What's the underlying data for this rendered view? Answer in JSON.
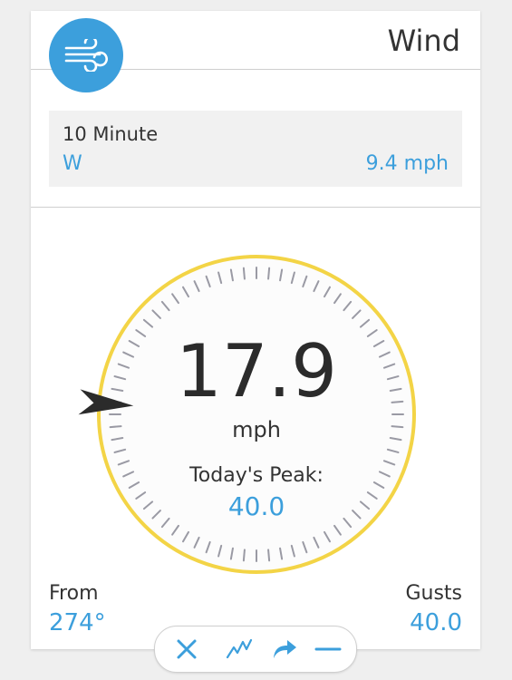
{
  "header": {
    "title": "Wind",
    "icon": "wind-icon"
  },
  "ten_minute": {
    "label": "10 Minute",
    "direction": "W",
    "speed": "9.4 mph"
  },
  "gauge": {
    "speed": "17.9",
    "unit": "mph",
    "peak_label": "Today's Peak:",
    "peak_value": "40.0",
    "direction_degrees": 274,
    "ring_color": "#f3d446"
  },
  "footer": {
    "from_label": "From",
    "from_value": "274°",
    "gusts_label": "Gusts",
    "gusts_value": "40.0"
  },
  "toolbar": {
    "items": [
      "close-icon",
      "trend-chart-icon",
      "share-arrow-icon",
      "minimize-icon"
    ]
  },
  "colors": {
    "accent": "#3c9fdc",
    "ring": "#f3d446",
    "text": "#333333"
  }
}
